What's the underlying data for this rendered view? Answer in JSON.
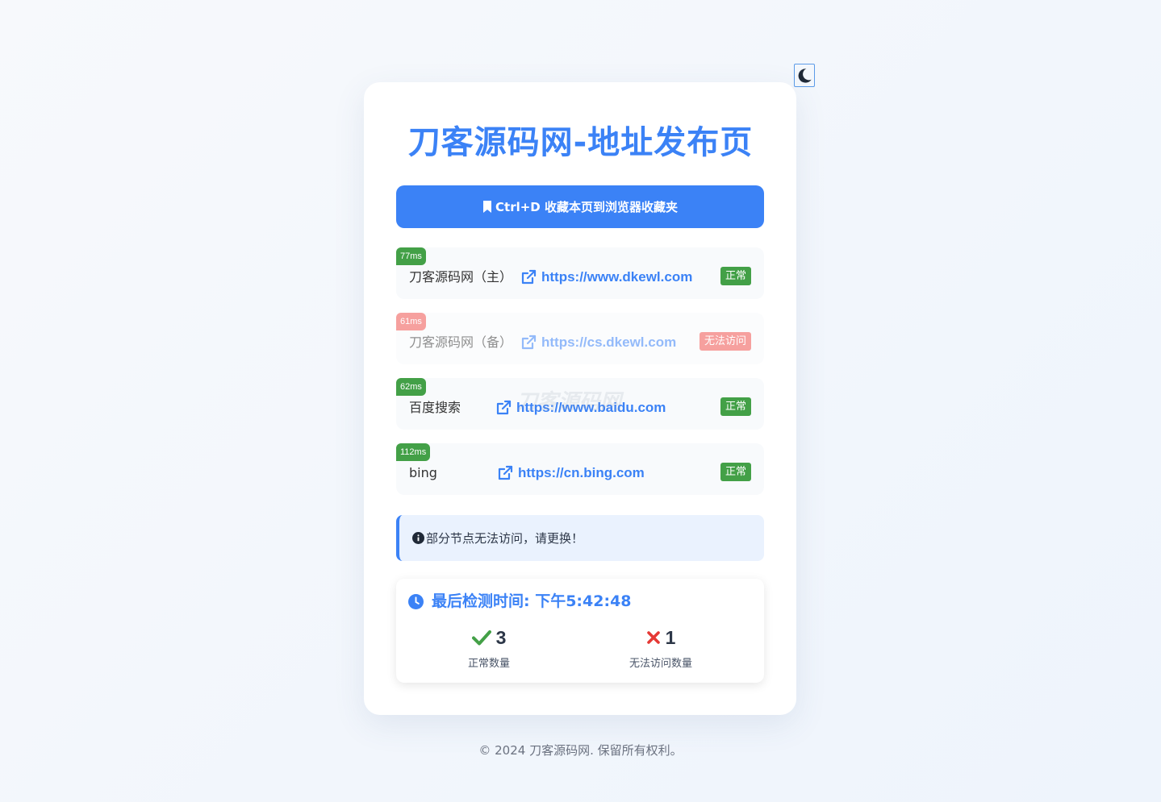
{
  "page": {
    "title": "刀客源码网-地址发布页",
    "theme_toggle_icon": "moon-icon",
    "bookmark_button_label": "Ctrl+D 收藏本页到浏览器收藏夹",
    "watermark": "刀客源码网"
  },
  "links": [
    {
      "latency": "77ms",
      "name": "刀客源码网（主）",
      "url": "https://www.dkewl.com",
      "status": "正常",
      "state": "ok"
    },
    {
      "latency": "61ms",
      "name": "刀客源码网（备）",
      "url": "https://cs.dkewl.com",
      "status": "无法访问",
      "state": "bad"
    },
    {
      "latency": "62ms",
      "name": "百度搜索",
      "url": "https://www.baidu.com",
      "status": "正常",
      "state": "ok"
    },
    {
      "latency": "112ms",
      "name": "bing",
      "url": "https://cn.bing.com",
      "status": "正常",
      "state": "ok"
    }
  ],
  "notice": {
    "text": "部分节点无法访问，请更换！",
    "icon": "info-circle-icon"
  },
  "stats": {
    "last_check": "最后检测时间: 下午5:42:48",
    "ok_count": "3",
    "ok_label": "正常数量",
    "fail_count": "1",
    "fail_label": "无法访问数量"
  },
  "colors": {
    "accent": "#3b82f6",
    "ok": "#43a047",
    "bad": "#ef5350",
    "fail_icon": "#e53935"
  },
  "footer": {
    "text": "© 2024 刀客源码网. 保留所有权利。"
  }
}
